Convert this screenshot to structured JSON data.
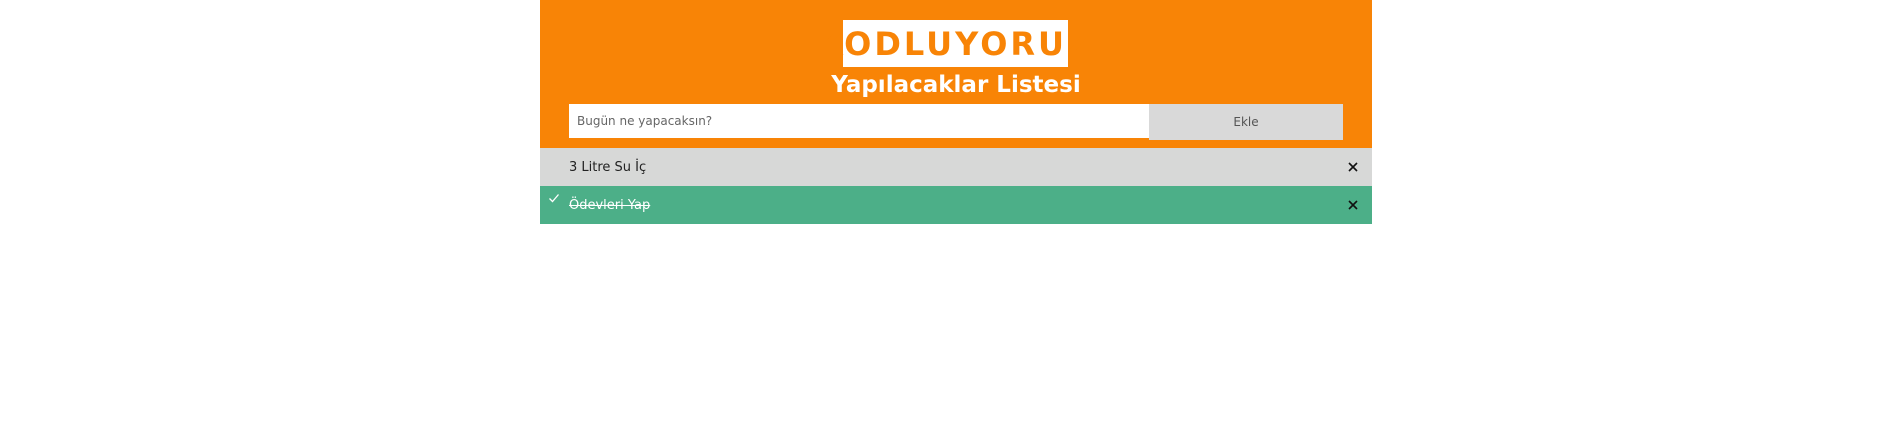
{
  "header": {
    "logo_text": "KODLUYORUZ",
    "title": "Yapılacaklar Listesi"
  },
  "form": {
    "input_value": "",
    "input_placeholder": "Bugün ne yapacaksın?",
    "add_button_label": "Ekle"
  },
  "todos": [
    {
      "text": "3 Litre Su İç",
      "status": "pending"
    },
    {
      "text": "Ödevleri Yap",
      "status": "done"
    }
  ],
  "colors": {
    "header_bg": "#f88406",
    "pending_bg": "#d7d8d7",
    "done_bg": "#4caf88",
    "button_bg": "#d9d9d9"
  },
  "icons": {
    "done_marker": "check-icon",
    "remove": "close-icon"
  }
}
